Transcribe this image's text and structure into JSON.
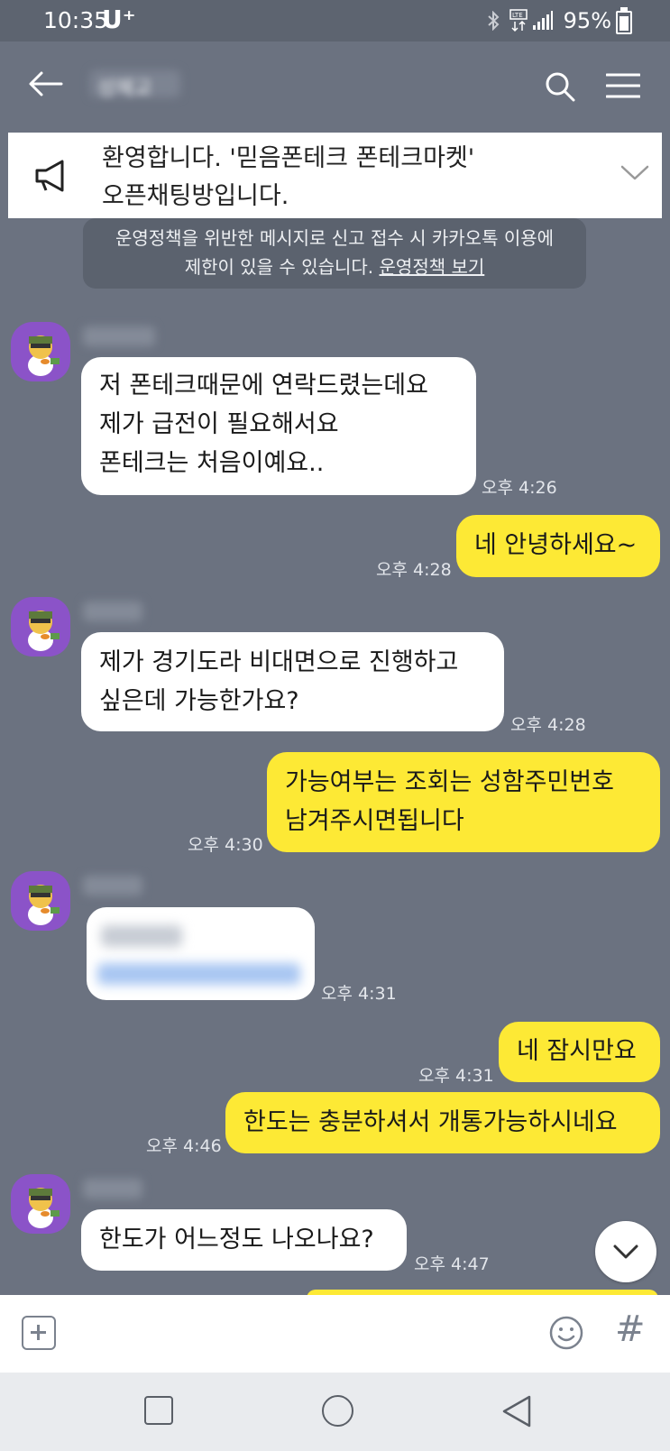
{
  "status_bar": {
    "time": "10:35",
    "carrier": "U⁺",
    "battery": "95%"
  },
  "header": {
    "title": "성혜교"
  },
  "notice": {
    "line1": "환영합니다. '믿음폰테크 폰테크마켓'",
    "line2": "오픈채팅방입니다."
  },
  "policy": {
    "line1": "운영정책을 위반한 메시지로 신고 접수 시 카카오톡 이용에",
    "line2_text": "제한이 있을 수 있습니다.",
    "link": "운영정책 보기"
  },
  "messages": [
    {
      "from": "other",
      "lines": [
        "저 폰테크때문에 연락드렸는데요",
        "제가 급전이 필요해서요",
        "폰테크는 처음이예요.."
      ],
      "time": "오후 4:26"
    },
    {
      "from": "me",
      "lines": [
        "네 안녕하세요~"
      ],
      "time": "오후 4:28"
    },
    {
      "from": "other",
      "lines": [
        "제가 경기도라 비대면으로 진행하고",
        "싶은데 가능한가요?"
      ],
      "time": "오후 4:28"
    },
    {
      "from": "me",
      "lines": [
        "가능여부는 조회는 성함주민번호",
        "남겨주시면됩니다"
      ],
      "time": "오후 4:30"
    },
    {
      "from": "other",
      "lines": [],
      "time": "오후 4:31"
    },
    {
      "from": "me",
      "lines": [
        "네 잠시만요"
      ],
      "time": "오후 4:31"
    },
    {
      "from": "me",
      "lines": [
        "한도는 충분하셔서 개통가능하시네요"
      ],
      "time": "오후 4:46"
    },
    {
      "from": "other",
      "lines": [
        "한도가 어느정도 나오나요?"
      ],
      "time": "오후 4:47"
    }
  ],
  "input_bar": {
    "hash": "#"
  },
  "icons": [
    "back-arrow-icon",
    "search-icon",
    "menu-icon",
    "megaphone-icon",
    "chevron-down-icon",
    "plus-icon",
    "emoji-icon",
    "hash-icon"
  ]
}
